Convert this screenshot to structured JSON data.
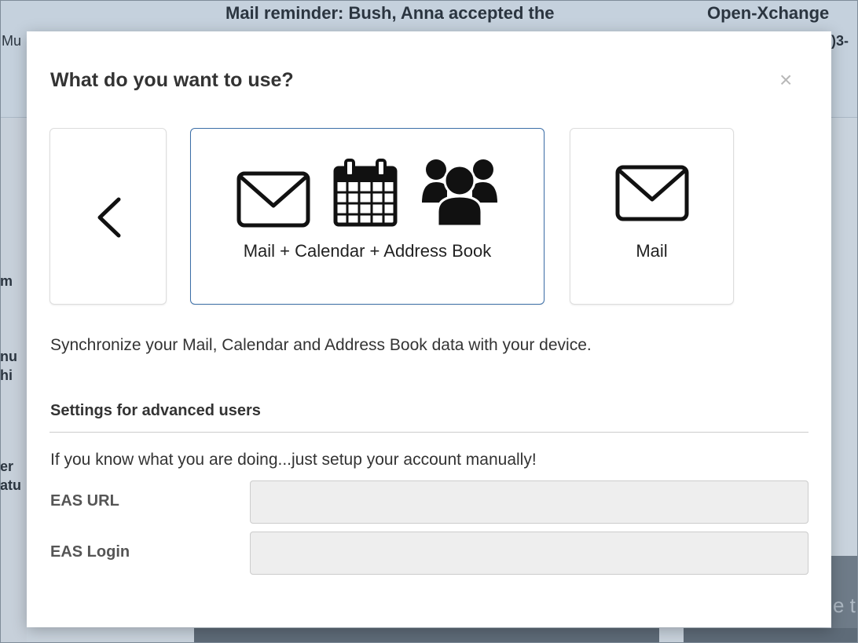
{
  "background": {
    "title_text": "Mail reminder: Bush, Anna accepted the",
    "right_text": "Open-Xchange",
    "right_subtext": ")3-",
    "left_snippet": "Mu",
    "side_snippets": [
      "m",
      "nu",
      "hi",
      "er",
      "atu"
    ],
    "bottom_right_snippet": "e t"
  },
  "modal": {
    "title": "What do you want to use?",
    "close_glyph": "×",
    "options": [
      {
        "id": "back",
        "label": "",
        "icons": [
          "chevron-left-icon"
        ]
      },
      {
        "id": "all",
        "label": "Mail + Calendar + Address Book",
        "icons": [
          "envelope-icon",
          "calendar-icon",
          "people-icon"
        ],
        "selected": true
      },
      {
        "id": "mail",
        "label": "Mail",
        "icons": [
          "envelope-icon"
        ]
      }
    ],
    "description": "Synchronize your Mail, Calendar and Address Book data with your device.",
    "advanced": {
      "title": "Settings for advanced users",
      "description": "If you know what you are doing...just setup your account manually!",
      "fields": [
        {
          "label": "EAS URL",
          "value": ""
        },
        {
          "label": "EAS Login",
          "value": ""
        }
      ]
    }
  },
  "colors": {
    "accent": "#3c6fa8",
    "text": "#333333",
    "input_bg": "#eeeeee"
  }
}
